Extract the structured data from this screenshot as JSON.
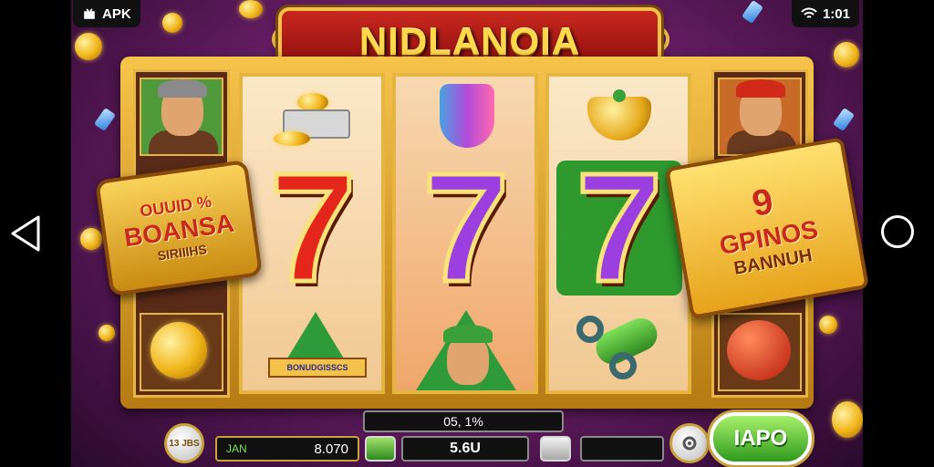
{
  "status_bar": {
    "apk_label": "APK",
    "time": "1:01"
  },
  "banner": {
    "title": "NIDLANOIA"
  },
  "bonus_badge": {
    "line1": "OUUID %",
    "line2": "BOANSA",
    "line3": "SIRIIIHS"
  },
  "spins_badge": {
    "count": "9",
    "line2": "GPINOS",
    "line3": "BANNUH"
  },
  "reels": [
    {
      "top_symbol": "coin-stack",
      "center_symbol": "7",
      "center_color": "#e5261a",
      "bottom_symbol": "bonus-ticket",
      "bottom_label": "BONUDGISSCS"
    },
    {
      "top_symbol": "horseshoe-magnet",
      "center_symbol": "7",
      "center_color": "#9b3fe0",
      "bottom_symbol": "character-portrait"
    },
    {
      "top_symbol": "golden-pot",
      "center_symbol": "7",
      "center_color": "#9b3fe0",
      "bottom_symbol": "green-tube"
    }
  ],
  "controls": {
    "top_value": "05, 1%",
    "balance_label": "JAN",
    "balance_value": "8.070",
    "bet_value": "5.6U",
    "win_value": "",
    "info_button_label": "13 JBS",
    "spin_label": "IAPO"
  },
  "colors": {
    "accent_gold": "#f3c24a",
    "banner_red": "#c8281e",
    "spin_green": "#2f9a1e"
  }
}
